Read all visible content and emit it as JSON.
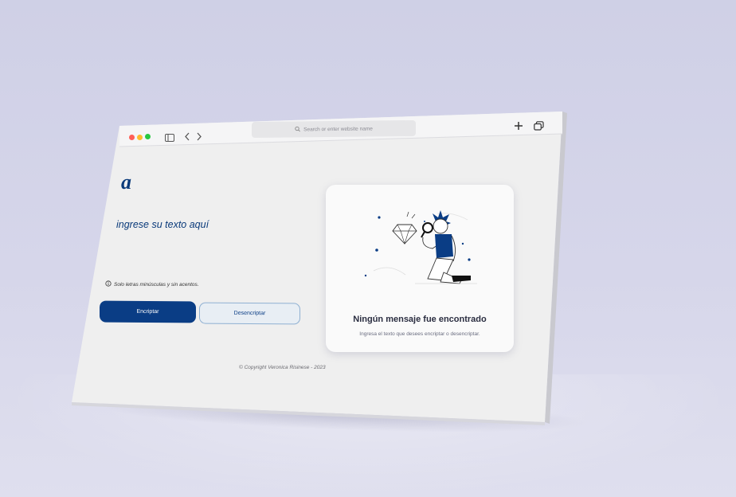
{
  "browser": {
    "address_bar": {
      "placeholder": "Search or enter website name"
    }
  },
  "app": {
    "logo": "a",
    "input_placeholder": "ingrese su texto aquí",
    "hint": "Solo letras minúsculas y sin acentos.",
    "encrypt_button": "Encriptar",
    "decrypt_button": "Desencriptar",
    "copyright": "© Copyright Veronica Risinese - 2023"
  },
  "result_card": {
    "title": "Ningún mensaje fue encontrado",
    "subtitle": "Ingresa el texto que desees encriptar o desencriptar."
  },
  "colors": {
    "primary": "#0a3d85",
    "text_dark": "#2a2d40",
    "close_dot": "#ff5f57",
    "minimize_dot": "#febc2e",
    "maximize_dot": "#28c840"
  }
}
